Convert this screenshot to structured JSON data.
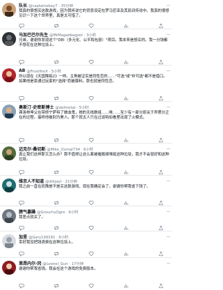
{
  "tweets": [
    {
      "name": "队长",
      "handle": "@captainobay7",
      "time": "35分钟",
      "text": "我真的很想买这款游戏，因为我听说它的背景设定在罗马尼亚及其民间传说中。我真的很想见识一下这个世界里，真是太可惜了。",
      "avatar": "avatar-illustrated-a"
    },
    {
      "name": "马加巴巴尔先生",
      "handle": "@MrMagabbagooi",
      "time": "3小时",
      "text": "兄弟，谢谢你发现这个\"DEI（多元化、公平和包容）\"项目。我本来是想买的。我一分钱都不想花在这种垃圾上。",
      "avatar": "avatar-dark"
    },
    {
      "name": "AB",
      "handle": "@FrostfireX",
      "time": "5小时",
      "text": "所以现在《天国降临2》一样。主角被证实是同性恋的……\"可选\"或\"非可选\"都不是借口。如果他是靠通过玩家的\"选择\"而被爆料，那也就是同性恋。",
      "avatar": "avatar-red"
    },
    {
      "name": "奥斯汀·史密斯博士",
      "handle": "@defmetal",
      "time": "5小时",
      "text": "弗洛林坤父在带修宁萨特了做血鬼，她的无线数组……唉……至少有一部分原关于异质分正在的过程。最终他被别为美人。那个就太人只在过滤特如看里出现了火模式。",
      "avatar": "avatar-man"
    },
    {
      "name": "迈克尔·桑切斯",
      "handle": "@Mike_Oxmal734",
      "time": "6小时",
      "text": "真让我们这样那又怎么办？那不值得让这么面被摧毁掉堆挺这种垃圾，我才不会就好和这种垃圾。",
      "avatar": "avatar-illustrated-b"
    },
    {
      "name": "维京人不知道",
      "handle": "@drkjayl",
      "time": "21分钟",
      "text": "我之前一直在犹豫是不是买这款游戏，现在我确定会了。谢谢你帮我省下钱了。",
      "avatar": "avatar-teal"
    },
    {
      "name": "脾气暴躁",
      "handle": "@GrouchyOgre",
      "time": "6小时",
      "text": "我差点就买了。",
      "avatar": "avatar-gray"
    },
    {
      "name": "加里",
      "handle": "@Gary199181",
      "time": "6小时",
      "text": "幸好我没把钱浪费在这种垃圾上。",
      "avatar": "avatar-light"
    },
    {
      "name": "莱昂内尔·冈",
      "handle": "@Leonel_Gun",
      "time": "17分钟",
      "text": "谢谢你帮我省钱。我会在这个游戏的免费版本。",
      "avatar": "avatar-red-b"
    }
  ]
}
